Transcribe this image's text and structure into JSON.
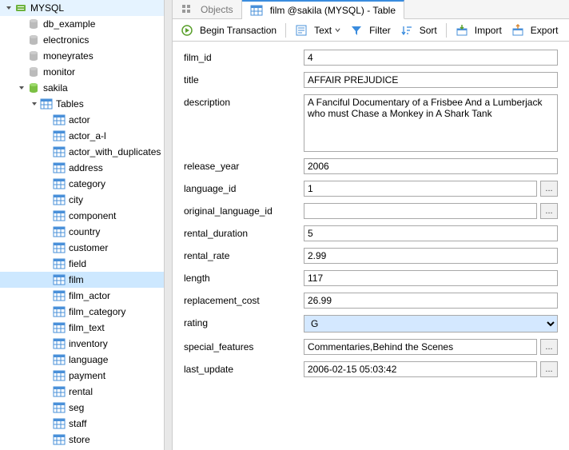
{
  "tree": {
    "root": "MYSQL",
    "databases": [
      "db_example",
      "electronics",
      "moneyrates",
      "monitor"
    ],
    "activeDb": "sakila",
    "tablesFolder": "Tables",
    "tables": [
      "actor",
      "actor_a-l",
      "actor_with_duplicates",
      "address",
      "category",
      "city",
      "component",
      "country",
      "customer",
      "field",
      "film",
      "film_actor",
      "film_category",
      "film_text",
      "inventory",
      "language",
      "payment",
      "rental",
      "seg",
      "staff",
      "store"
    ],
    "selected": "film"
  },
  "tabs": {
    "inactive": "Objects",
    "active": "film @sakila (MYSQL) - Table"
  },
  "toolbar": {
    "begin": "Begin Transaction",
    "text": "Text",
    "filter": "Filter",
    "sort": "Sort",
    "import": "Import",
    "export": "Export"
  },
  "fields": {
    "film_id": {
      "label": "film_id",
      "value": "4"
    },
    "title": {
      "label": "title",
      "value": "AFFAIR PREJUDICE"
    },
    "description": {
      "label": "description",
      "value": "A Fanciful Documentary of a Frisbee And a Lumberjack who must Chase a Monkey in A Shark Tank"
    },
    "release_year": {
      "label": "release_year",
      "value": "2006"
    },
    "language_id": {
      "label": "language_id",
      "value": "1"
    },
    "original_language_id": {
      "label": "original_language_id",
      "value": ""
    },
    "rental_duration": {
      "label": "rental_duration",
      "value": "5"
    },
    "rental_rate": {
      "label": "rental_rate",
      "value": "2.99"
    },
    "length": {
      "label": "length",
      "value": "117"
    },
    "replacement_cost": {
      "label": "replacement_cost",
      "value": "26.99"
    },
    "rating": {
      "label": "rating",
      "value": "G"
    },
    "special_features": {
      "label": "special_features",
      "value": "Commentaries,Behind the Scenes"
    },
    "last_update": {
      "label": "last_update",
      "value": "2006-02-15 05:03:42"
    }
  },
  "moreBtn": "..."
}
